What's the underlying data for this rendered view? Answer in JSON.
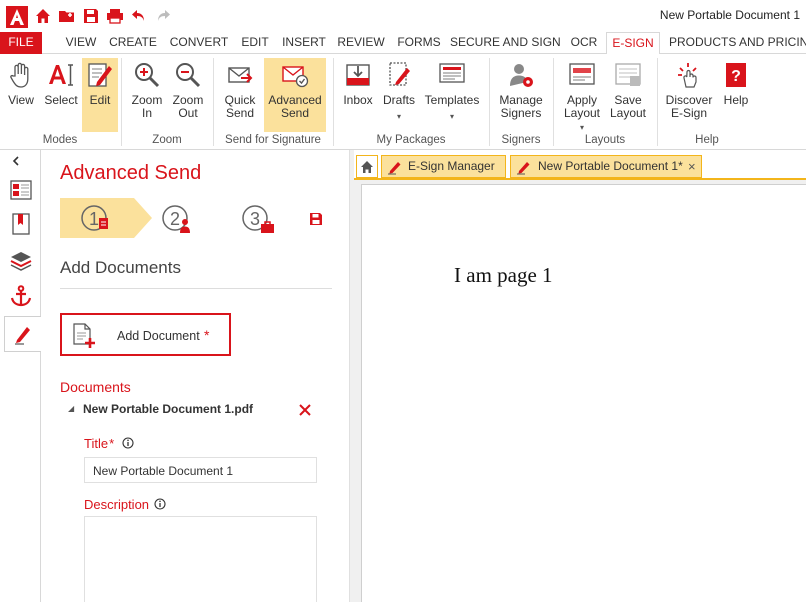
{
  "window": {
    "title": "New Portable Document 1"
  },
  "tabs": [
    {
      "label": "FILE"
    },
    {
      "label": "VIEW"
    },
    {
      "label": "CREATE"
    },
    {
      "label": "CONVERT"
    },
    {
      "label": "EDIT"
    },
    {
      "label": "INSERT"
    },
    {
      "label": "REVIEW"
    },
    {
      "label": "FORMS"
    },
    {
      "label": "SECURE AND SIGN"
    },
    {
      "label": "OCR"
    },
    {
      "label": "E-SIGN"
    },
    {
      "label": "PRODUCTS AND PRICING"
    }
  ],
  "ribbon": {
    "buttons": {
      "view": [
        "View"
      ],
      "select": [
        "Select"
      ],
      "edit": [
        "Edit"
      ],
      "zoom_in": [
        "Zoom",
        "In"
      ],
      "zoom_out": [
        "Zoom",
        "Out"
      ],
      "quick_send": [
        "Quick",
        "Send"
      ],
      "advanced_send": [
        "Advanced",
        "Send"
      ],
      "inbox": [
        "Inbox"
      ],
      "drafts": [
        "Drafts"
      ],
      "templates": [
        "Templates"
      ],
      "manage_signers": [
        "Manage",
        "Signers"
      ],
      "apply_layout": [
        "Apply",
        "Layout"
      ],
      "save_layout": [
        "Save",
        "Layout"
      ],
      "discover_esign": [
        "Discover",
        "E-Sign"
      ],
      "help": [
        "Help"
      ]
    },
    "groups": {
      "modes": "Modes",
      "zoom": "Zoom",
      "send": "Send for Signature",
      "packages": "My Packages",
      "signers": "Signers",
      "layouts": "Layouts",
      "help": "Help"
    }
  },
  "panel": {
    "title": "Advanced Send",
    "steps": [
      "1",
      "2",
      "3"
    ],
    "section_title": "Add Documents",
    "add_document_label": "Add Document",
    "required_mark": "*",
    "documents_label": "Documents",
    "document_name": "New Portable Document 1.pdf",
    "title_label": "Title",
    "title_value": "New Portable Document 1",
    "description_label": "Description",
    "description_value": ""
  },
  "doc_tabs": {
    "esign_manager": "E-Sign Manager",
    "document": "New Portable Document 1*",
    "close": "×"
  },
  "page_content": {
    "text": "I am page 1"
  },
  "colors": {
    "accent": "#d9141b",
    "highlight": "#fbe19c",
    "tab_border": "#f3b51b"
  }
}
